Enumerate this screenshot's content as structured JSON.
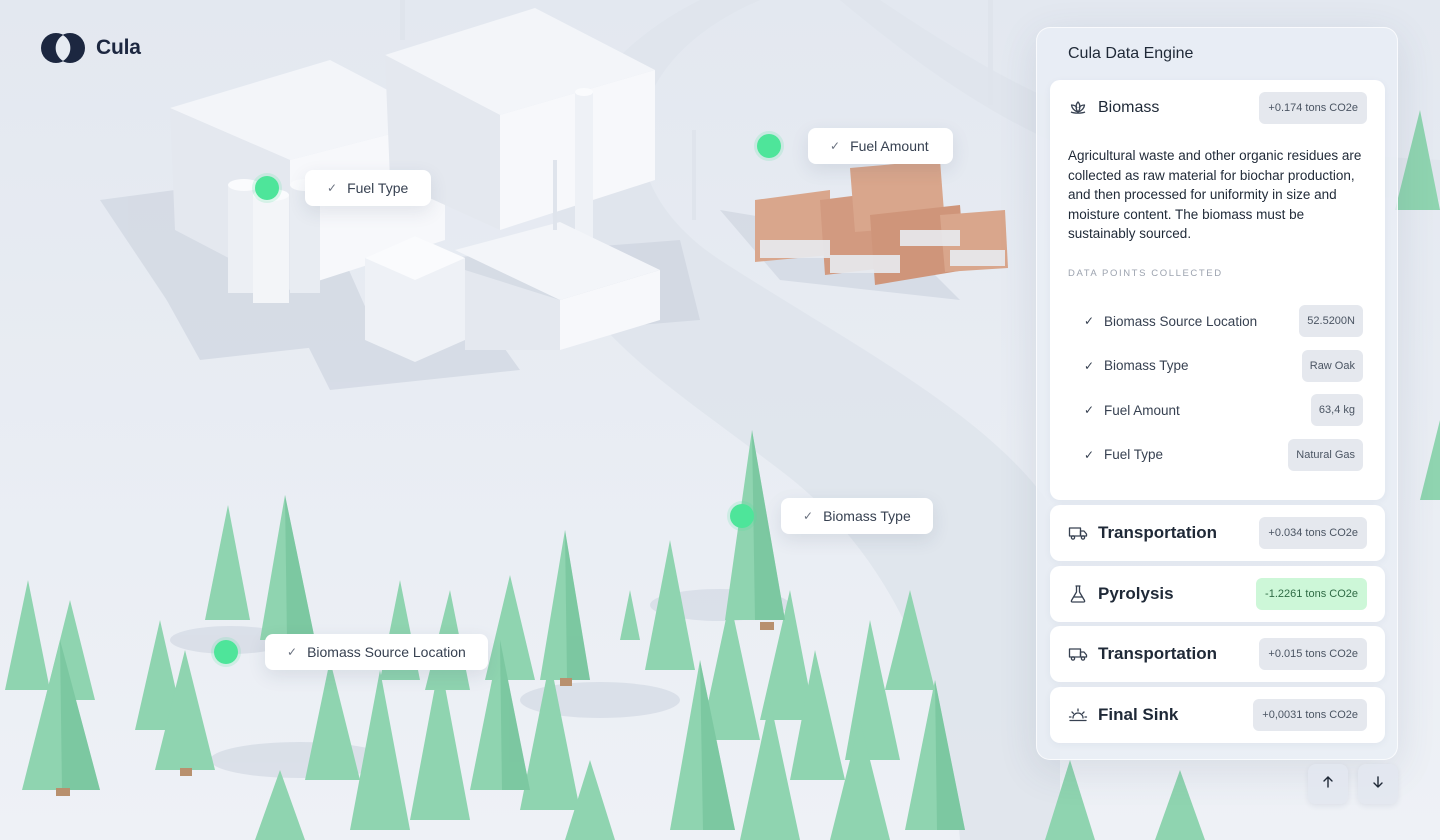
{
  "brand": {
    "name": "Cula"
  },
  "map_labels": [
    {
      "label": "Fuel Type"
    },
    {
      "label": "Fuel Amount"
    },
    {
      "label": "Biomass Type"
    },
    {
      "label": "Biomass Source Location"
    }
  ],
  "panel": {
    "title": "Cula Data Engine",
    "biomass": {
      "title": "Biomass",
      "badge": "+0.174 tons CO2e",
      "description": "Agricultural waste and other organic residues are collected as raw material for biochar production, and then processed for uniformity in size and moisture content. The biomass must be sustainably sourced.",
      "section_label": "DATA POINTS COLLECTED",
      "data_points": [
        {
          "label": "Biomass Source Location",
          "value": "52.5200N"
        },
        {
          "label": "Biomass Type",
          "value": "Raw Oak"
        },
        {
          "label": "Fuel Amount",
          "value": "63,4 kg"
        },
        {
          "label": "Fuel Type",
          "value": "Natural Gas"
        }
      ]
    },
    "stages": [
      {
        "title": "Transportation",
        "badge": "+0.034 tons CO2e",
        "icon": "truck-icon",
        "badge_color": "#e5e8ee"
      },
      {
        "title": "Pyrolysis",
        "badge": "-1.2261 tons CO2e",
        "icon": "flask-icon",
        "badge_color": "#cdf7d8"
      },
      {
        "title": "Transportation",
        "badge": "+0.015 tons CO2e",
        "icon": "truck-icon",
        "badge_color": "#e5e8ee"
      },
      {
        "title": "Final Sink",
        "badge": "+0,0031 tons CO2e",
        "icon": "sunset-icon",
        "badge_color": "#e5e8ee"
      }
    ]
  },
  "colors": {
    "accent_green": "#4ee59a",
    "brand_navy": "#1c2740"
  }
}
